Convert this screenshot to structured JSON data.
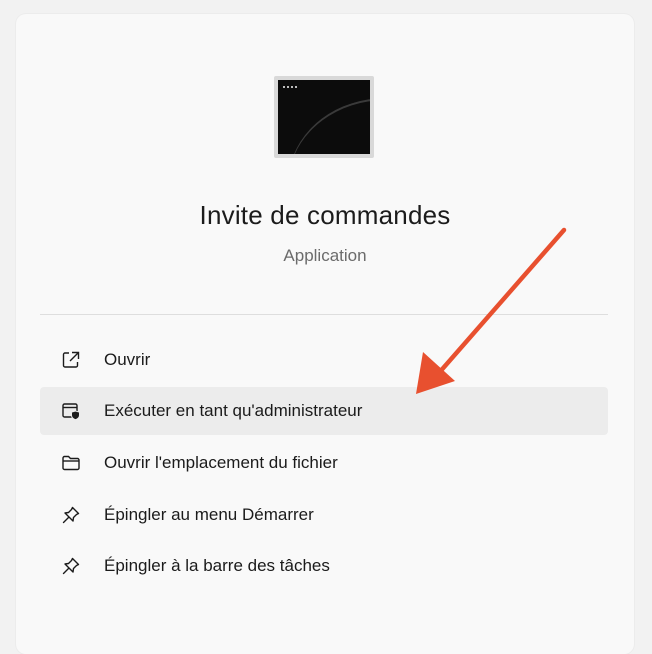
{
  "app": {
    "title": "Invite de commandes",
    "subtitle": "Application",
    "icon": "command-prompt-icon"
  },
  "menu": {
    "items": [
      {
        "label": "Ouvrir",
        "icon": "open-external-icon"
      },
      {
        "label": "Exécuter en tant qu'administrateur",
        "icon": "run-as-admin-shield-icon",
        "highlighted": true
      },
      {
        "label": "Ouvrir l'emplacement du fichier",
        "icon": "folder-icon"
      },
      {
        "label": "Épingler au menu Démarrer",
        "icon": "pin-icon"
      },
      {
        "label": "Épingler à la barre des tâches",
        "icon": "pin-icon"
      }
    ]
  },
  "colors": {
    "annotation_arrow": "#e8502f",
    "panel_background": "#f9f9f9",
    "highlight_background": "#ececec"
  }
}
